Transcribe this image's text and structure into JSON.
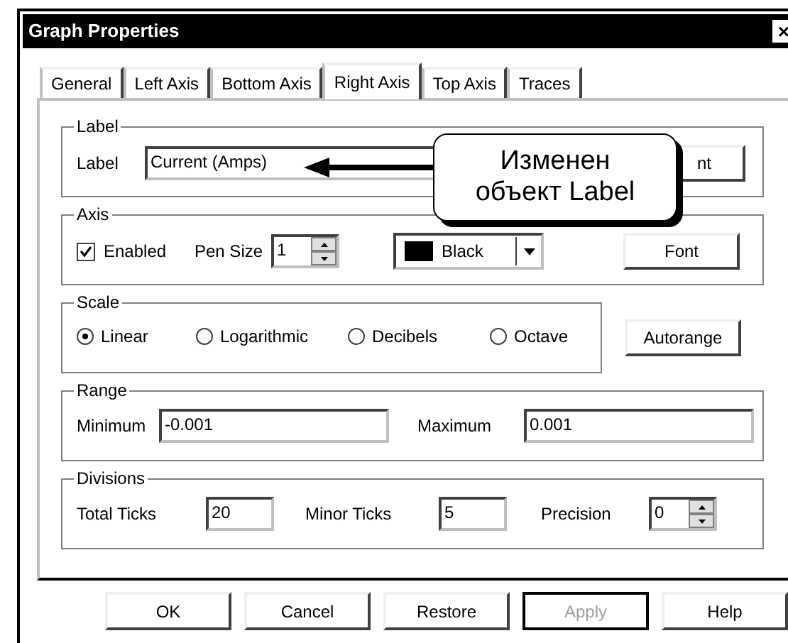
{
  "window": {
    "title": "Graph Properties",
    "close": "×"
  },
  "tabs": [
    {
      "label": "General",
      "selected": false
    },
    {
      "label": "Left Axis",
      "selected": false
    },
    {
      "label": "Bottom Axis",
      "selected": false
    },
    {
      "label": "Right Axis",
      "selected": true
    },
    {
      "label": "Top Axis",
      "selected": false
    },
    {
      "label": "Traces",
      "selected": false
    }
  ],
  "label_group": {
    "title": "Label",
    "field_label": "Label",
    "value": "Current (Amps)",
    "font_button": "nt"
  },
  "callout": {
    "text": "Изменен объект Label"
  },
  "axis_group": {
    "title": "Axis",
    "enabled": {
      "label": "Enabled",
      "checked": true
    },
    "pen_size_label": "Pen Size",
    "pen_size": "1",
    "color": {
      "label": "Black",
      "color": "#000000"
    },
    "font_button": "Font"
  },
  "scale_group": {
    "title": "Scale",
    "options": [
      {
        "label": "Linear",
        "selected": true
      },
      {
        "label": "Logarithmic",
        "selected": false
      },
      {
        "label": "Decibels",
        "selected": false
      },
      {
        "label": "Octave",
        "selected": false
      }
    ]
  },
  "autorange_button": "Autorange",
  "range_group": {
    "title": "Range",
    "minimum_label": "Minimum",
    "minimum": "-0.001",
    "maximum_label": "Maximum",
    "maximum": "0.001"
  },
  "divisions_group": {
    "title": "Divisions",
    "total_ticks_label": "Total Ticks",
    "total_ticks": "20",
    "minor_ticks_label": "Minor Ticks",
    "minor_ticks": "5",
    "precision_label": "Precision",
    "precision": "0"
  },
  "buttons": [
    {
      "label": "OK",
      "disabled": false
    },
    {
      "label": "Cancel",
      "disabled": false
    },
    {
      "label": "Restore",
      "disabled": false
    },
    {
      "label": "Apply",
      "disabled": true
    },
    {
      "label": "Help",
      "disabled": false
    }
  ]
}
